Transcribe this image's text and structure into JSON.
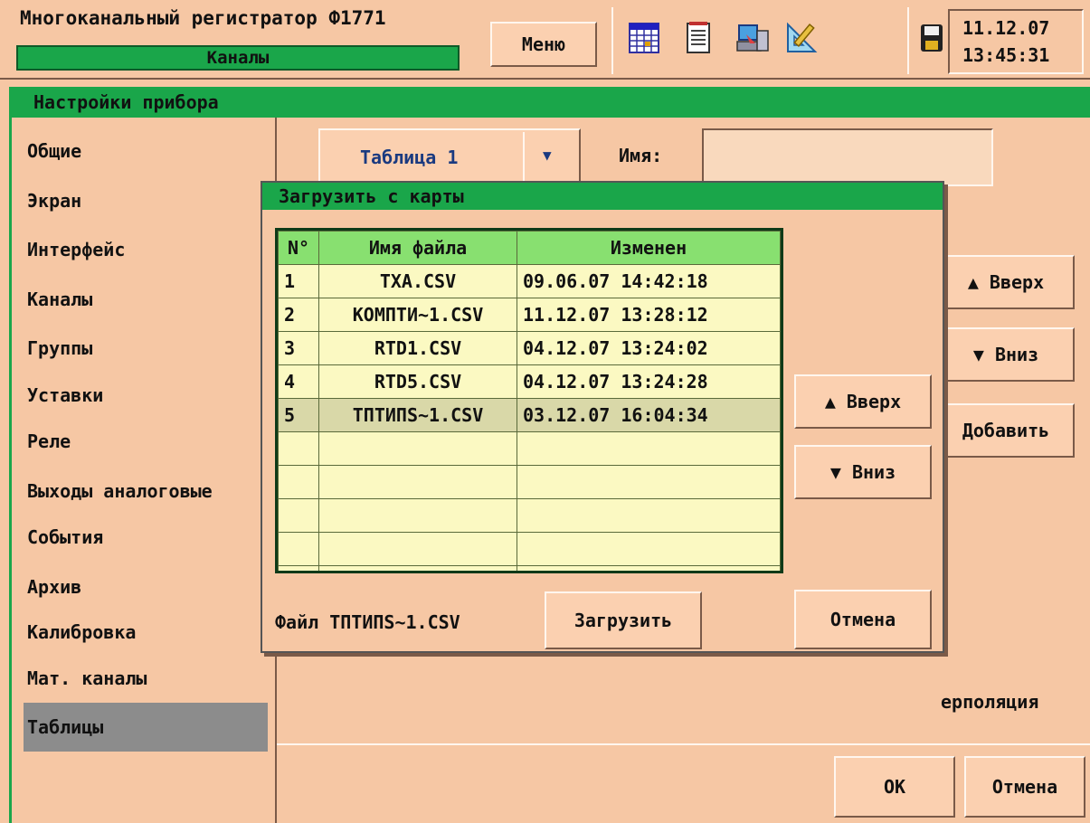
{
  "header": {
    "title": "Многоканальный регистратор Ф1771",
    "subtitle": "Каналы",
    "menu_label": "Меню",
    "date": "11.12.07",
    "time": "13:45:31"
  },
  "panel": {
    "title": "Настройки прибора"
  },
  "sidebar": {
    "items": [
      {
        "label": "Общие"
      },
      {
        "label": "Экран"
      },
      {
        "label": "Интерфейс"
      },
      {
        "label": "Каналы"
      },
      {
        "label": "Группы"
      },
      {
        "label": "Уставки"
      },
      {
        "label": "Реле"
      },
      {
        "label": "Выходы аналоговые"
      },
      {
        "label": "События"
      },
      {
        "label": "Архив"
      },
      {
        "label": "Калибровка"
      },
      {
        "label": "Мат. каналы"
      },
      {
        "label": "Таблицы"
      }
    ]
  },
  "main": {
    "table_select": "Таблица 1",
    "name_label": "Имя:",
    "name_value": "",
    "up_label": "▲ Вверх",
    "down_label": "▼ Вниз",
    "add_label": "Добавить",
    "interp_label": "ерполяция",
    "ok_label": "OK",
    "cancel_label": "Отмена"
  },
  "dialog": {
    "title": "Загрузить с карты",
    "columns": [
      "N°",
      "Имя файла",
      "Изменен"
    ],
    "rows": [
      {
        "n": "1",
        "file": "TXA.CSV",
        "modified": "09.06.07 14:42:18"
      },
      {
        "n": "2",
        "file": "КОМПТИ~1.CSV",
        "modified": "11.12.07 13:28:12"
      },
      {
        "n": "3",
        "file": "RTD1.CSV",
        "modified": "04.12.07 13:24:02"
      },
      {
        "n": "4",
        "file": "RTD5.CSV",
        "modified": "04.12.07 13:24:28"
      },
      {
        "n": "5",
        "file": "ТПТИПS~1.CSV",
        "modified": "03.12.07 16:04:34"
      }
    ],
    "up_label": "▲ Вверх",
    "down_label": "▼ Вниз",
    "file_text": "Файл ТПТИПS~1.CSV",
    "load_label": "Загрузить",
    "cancel_label": "Отмена"
  },
  "colors": {
    "background": "#f6c7a4",
    "green": "#1aa64a",
    "table_header": "#88e070",
    "table_body": "#fbf9c2"
  }
}
